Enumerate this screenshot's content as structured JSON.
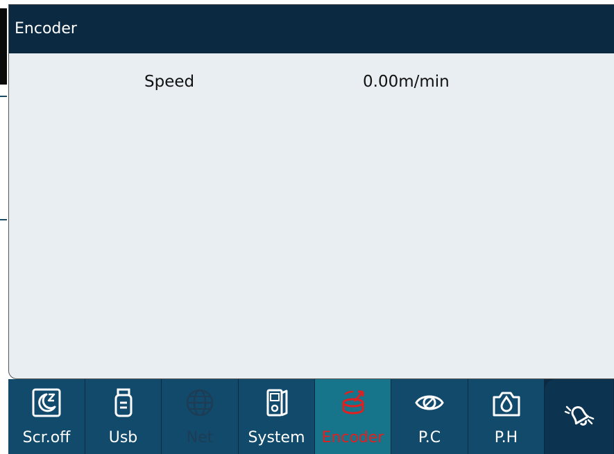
{
  "window": {
    "title": "Encoder"
  },
  "content": {
    "rows": [
      {
        "label": "Speed",
        "value": "0.00m/min"
      }
    ]
  },
  "nav": {
    "active": "Encoder",
    "items": [
      {
        "label": "Scr.off",
        "icon": "screen-off-icon",
        "state": "normal"
      },
      {
        "label": "Usb",
        "icon": "usb-icon",
        "state": "normal"
      },
      {
        "label": "Net",
        "icon": "globe-icon",
        "state": "disabled"
      },
      {
        "label": "System",
        "icon": "system-device-icon",
        "state": "normal"
      },
      {
        "label": "Encoder",
        "icon": "encoder-icon",
        "state": "active"
      },
      {
        "label": "P.C",
        "icon": "eye-icon",
        "state": "normal"
      },
      {
        "label": "P.H",
        "icon": "camera-drop-icon",
        "state": "normal"
      },
      {
        "label": "",
        "icon": "bell-ringing-icon",
        "state": "normal"
      }
    ]
  },
  "colors": {
    "header": "#0b2a41",
    "nav_item": "#124a6c",
    "nav_active": "#16758a",
    "active_label": "#e02020",
    "disabled_label": "#1c3d55",
    "panel_bg": "#e9eef2"
  }
}
